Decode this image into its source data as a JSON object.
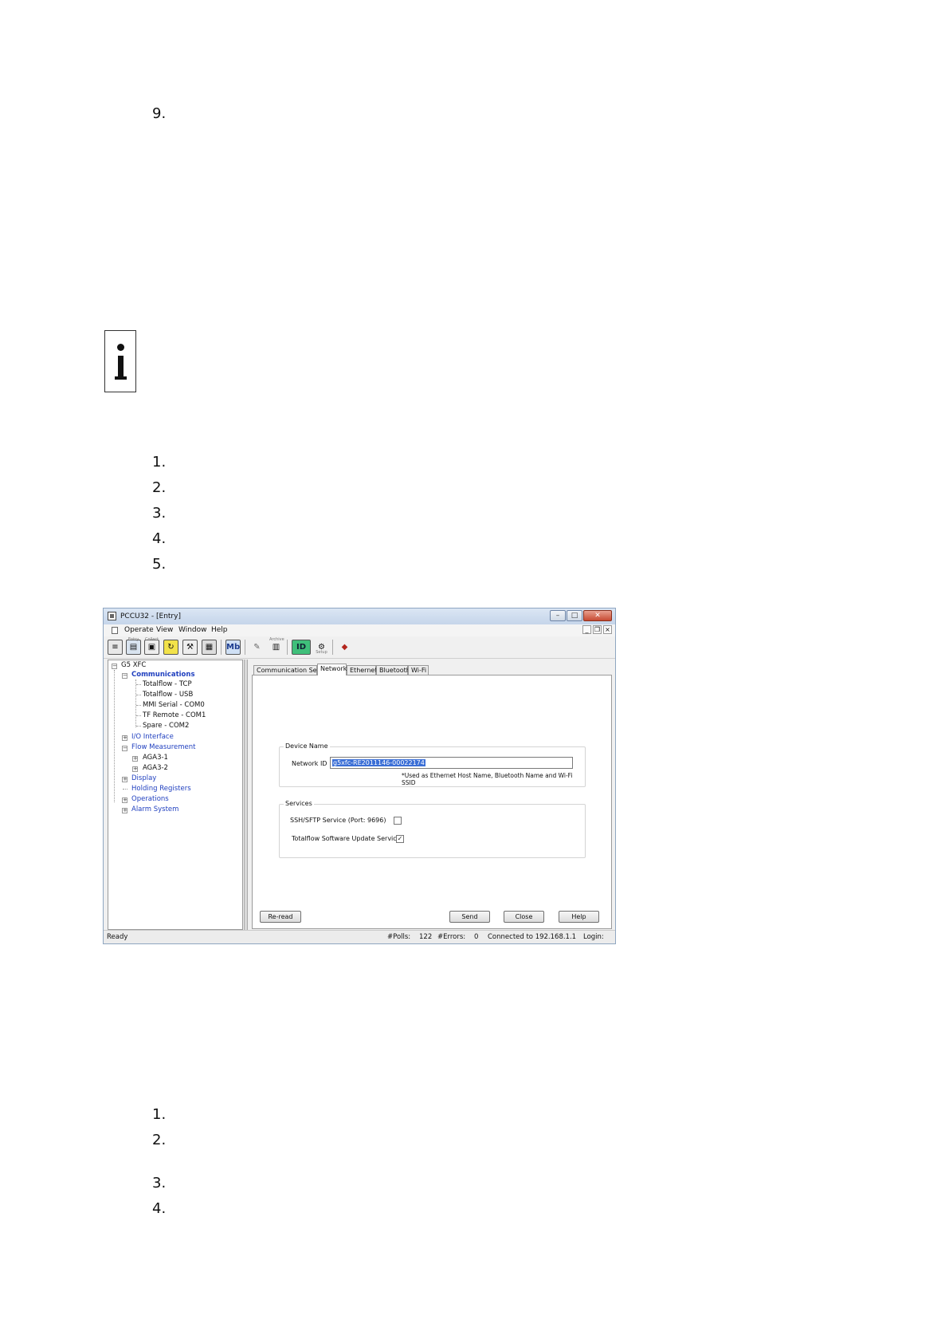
{
  "document": {
    "step_top": "9.",
    "list_a": [
      "1.",
      "2.",
      "3.",
      "4.",
      "5."
    ],
    "list_b": [
      "1.",
      "2.",
      "3.",
      "4."
    ]
  },
  "window": {
    "title": "PCCU32 - [Entry]",
    "titlebar_buttons": {
      "minimize": "–",
      "maximize": "□",
      "close": "✕"
    },
    "menu": [
      "Operate",
      "View",
      "Window",
      "Help"
    ],
    "mdi_buttons": {
      "minimize": "_",
      "restore": "×",
      "close": "×"
    },
    "toolbar_labels": {
      "tool2": "Entry",
      "tool3": "Collect",
      "archive": "Archive",
      "setup": "Setup",
      "id": "ID",
      "mb": "Mb"
    },
    "tree": {
      "root": "G5 XFC",
      "communications": "Communications",
      "comm_children": [
        "Totalflow - TCP",
        "Totalflow - USB",
        "MMI Serial - COM0",
        "TF Remote - COM1",
        "Spare - COM2"
      ],
      "io_interface": "I/O Interface",
      "flow_measurement": "Flow Measurement",
      "flow_children": [
        "AGA3-1",
        "AGA3-2"
      ],
      "display": "Display",
      "holding_registers": "Holding Registers",
      "operations": "Operations",
      "alarm_system": "Alarm System"
    },
    "tabs": [
      "Communication Setup",
      "Network",
      "Ethernet",
      "Bluetooth",
      "Wi-Fi"
    ],
    "device_name": {
      "group_title": "Device Name",
      "network_id_label": "Network ID",
      "network_id_value": "g5xfc-RE2011146-00022174",
      "note": "*Used as Ethernet Host Name, Bluetooth Name and Wi-Fi SSID"
    },
    "services": {
      "group_title": "Services",
      "ssh_label": "SSH/SFTP Service (Port: 9696)",
      "ssh_checked": "",
      "update_label": "Totalflow Software Update Service",
      "update_checked": "✓"
    },
    "buttons": {
      "reread": "Re-read",
      "send": "Send",
      "close": "Close",
      "help": "Help"
    },
    "status": {
      "ready": "Ready",
      "polls_label": "#Polls:",
      "polls_value": "122",
      "errors_label": "#Errors:",
      "errors_value": "0",
      "connected": "Connected to 192.168.1.1",
      "login": "Login:"
    }
  }
}
